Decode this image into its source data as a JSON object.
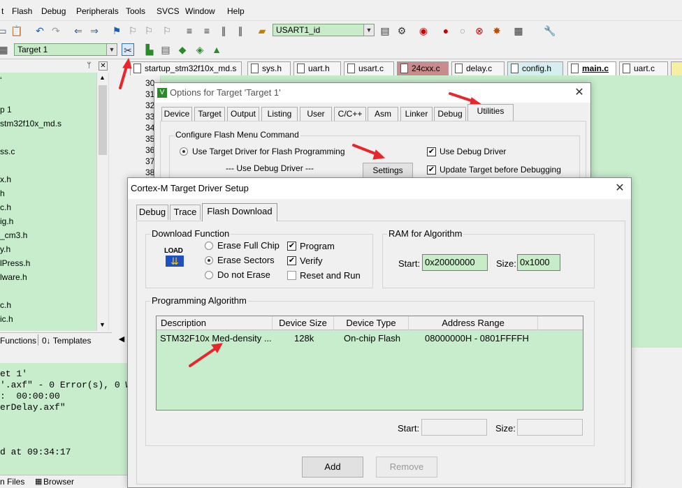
{
  "menu": [
    "t",
    "Flash",
    "Debug",
    "Peripherals",
    "Tools",
    "SVCS",
    "Window",
    "Help"
  ],
  "toolbar": {
    "target_combo": "USART1_id",
    "project_combo": "Target 1"
  },
  "left_panel": {
    "items": [
      "ʻ",
      "p 1",
      "stm32f10x_md.s",
      "ss.c",
      "x.h",
      "h",
      "c.h",
      "ig.h",
      "_cm3.h",
      "y.h",
      "lPress.h",
      "lware.h",
      "c.h",
      "ic.h"
    ],
    "tabs": [
      "Functions",
      "0↓ Templates"
    ]
  },
  "file_tabs": [
    "startup_stm32f10x_md.s",
    "sys.h",
    "uart.h",
    "usart.c",
    "24cxx.c",
    "delay.c",
    "config.h",
    "main.c",
    "uart.c"
  ],
  "editor": {
    "line_numbers": [
      "30",
      "31",
      "32",
      "33",
      "34",
      "35",
      "36",
      "37",
      "38"
    ]
  },
  "build_output": {
    "lines": [
      "et 1'",
      "'.axf\" - 0 Error(s), 0 W",
      ":  00:00:00",
      "erDelay.axf\"",
      "d at 09:34:17"
    ],
    "tabs": [
      "n Files",
      "Browser"
    ]
  },
  "options_dialog": {
    "title": "Options for Target 'Target 1'",
    "tabs": [
      "Device",
      "Target",
      "Output",
      "Listing",
      "User",
      "C/C++",
      "Asm",
      "Linker",
      "Debug",
      "Utilities"
    ],
    "group_label": "Configure Flash Menu Command",
    "radio_label": "Use Target Driver for Flash Programming",
    "debug_driver_label": "--- Use Debug Driver ---",
    "settings_button": "Settings",
    "check_use_debug": "Use Debug Driver",
    "check_update_target": "Update Target before Debugging"
  },
  "driver_dialog": {
    "title": "Cortex-M Target Driver Setup",
    "tabs": [
      "Debug",
      "Trace",
      "Flash Download"
    ],
    "download_function": {
      "label": "Download Function",
      "load_icon_text": "LOAD",
      "radios": [
        "Erase Full Chip",
        "Erase Sectors",
        "Do not Erase"
      ],
      "checks": [
        "Program",
        "Verify",
        "Reset and Run"
      ]
    },
    "ram": {
      "label": "RAM for Algorithm",
      "start_label": "Start:",
      "start_value": "0x20000000",
      "size_label": "Size:",
      "size_value": "0x1000"
    },
    "prog_algo": {
      "label": "Programming Algorithm",
      "columns": [
        "Description",
        "Device Size",
        "Device Type",
        "Address Range"
      ],
      "row": [
        "STM32F10x Med-density ...",
        "128k",
        "On-chip Flash",
        "08000000H - 0801FFFFH"
      ],
      "start_label": "Start:",
      "size_label": "Size:"
    },
    "add_button": "Add",
    "remove_button": "Remove"
  },
  "colors": {
    "editor_bg": "#c7edcc",
    "field_green": "#c8ecc8",
    "annotation_red": "#e8262c"
  }
}
